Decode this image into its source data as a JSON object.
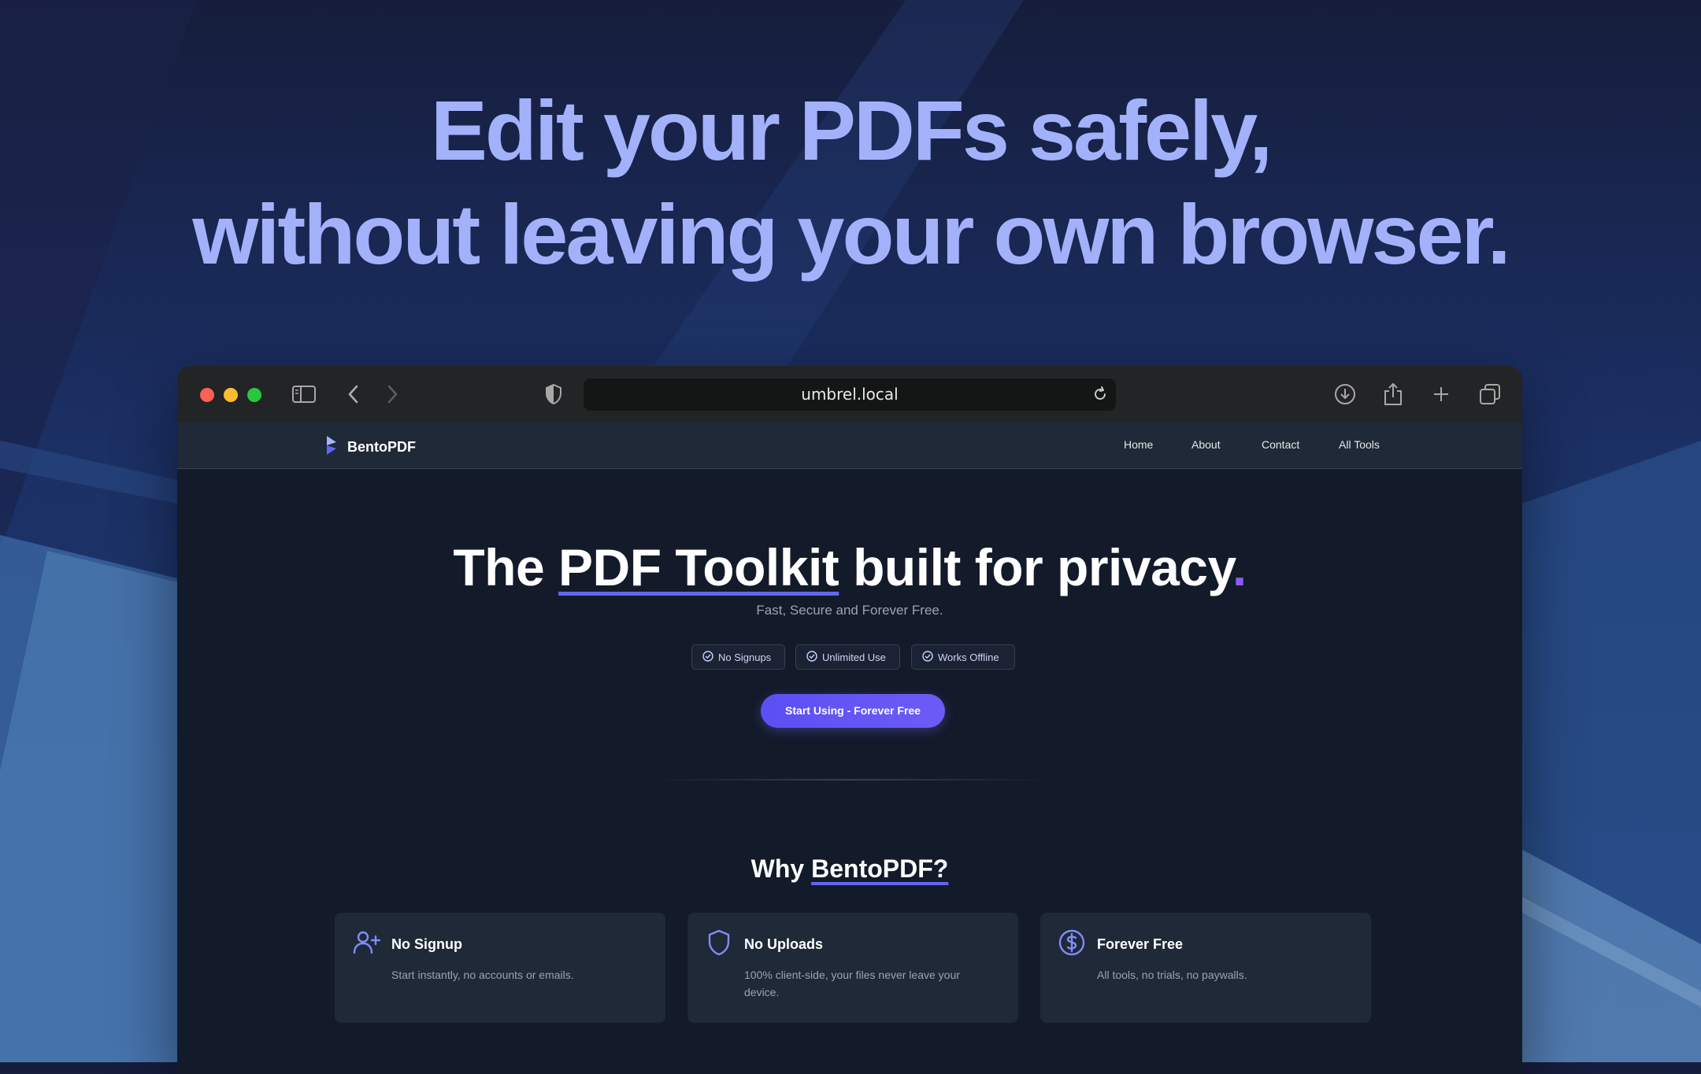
{
  "hero": {
    "line1": "Edit your PDFs safely,",
    "line2": "without leaving your own browser."
  },
  "browser": {
    "url": "umbrel.local",
    "icons": [
      "sidebar-icon",
      "back-icon",
      "forward-icon",
      "shield-icon",
      "reload-icon",
      "download-icon",
      "share-icon",
      "new-tab-icon",
      "tabs-overview-icon"
    ]
  },
  "navbar": {
    "brand": "BentoPDF",
    "links": [
      "Home",
      "About",
      "Contact",
      "All Tools"
    ]
  },
  "main": {
    "headline_pre": "The ",
    "headline_highlight": "PDF Toolkit",
    "headline_post": " built for privacy",
    "headline_dot": ".",
    "subtitle": "Fast, Secure and Forever Free.",
    "badges": [
      "No Signups",
      "Unlimited Use",
      "Works Offline"
    ],
    "cta": "Start Using - Forever Free"
  },
  "why": {
    "pre": "Why ",
    "highlight": "BentoPDF?"
  },
  "features": [
    {
      "icon": "user-plus-icon",
      "title": "No Signup",
      "desc": "Start instantly, no accounts or emails."
    },
    {
      "icon": "shield-icon",
      "title": "No Uploads",
      "desc": "100% client-side, your files never leave your device."
    },
    {
      "icon": "dollar-icon",
      "title": "Forever Free",
      "desc": "All tools, no trials, no paywalls."
    }
  ],
  "colors": {
    "accent": "#6366f1",
    "hero_text": "#a3b1fb",
    "page_bg": "#131a2a",
    "card_bg": "#1f2937"
  }
}
